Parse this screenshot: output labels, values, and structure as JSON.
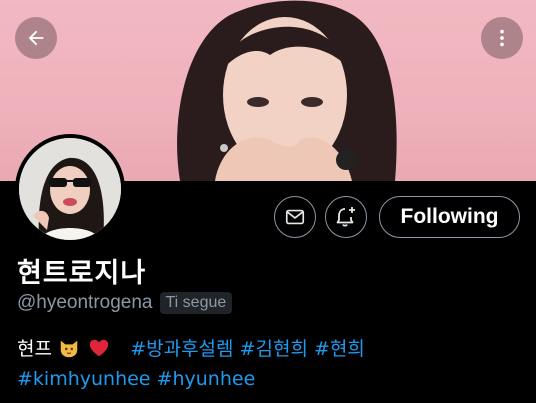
{
  "profile": {
    "display_name": "현트로지나",
    "handle": "@hyeontrogena",
    "follows_you_badge": "Ti segue",
    "bio_text": "현프",
    "bio_emojis": [
      "cat-face-emoji",
      "red-heart-emoji"
    ],
    "hashtags_line1": [
      "#방과후설렘",
      "#김현희",
      "#현희"
    ],
    "hashtags_line2": [
      "#kimhyunhee",
      "#hyunhee"
    ]
  },
  "actions": {
    "follow_label": "Following"
  },
  "icons": {
    "back": "back-arrow-icon",
    "more": "more-vertical-icon",
    "message": "envelope-icon",
    "notify": "bell-plus-icon"
  },
  "colors": {
    "background": "#000000",
    "accent": "#1d9bf0",
    "secondary_text": "#8b98a5",
    "banner_pink": "#f2b9c2"
  }
}
